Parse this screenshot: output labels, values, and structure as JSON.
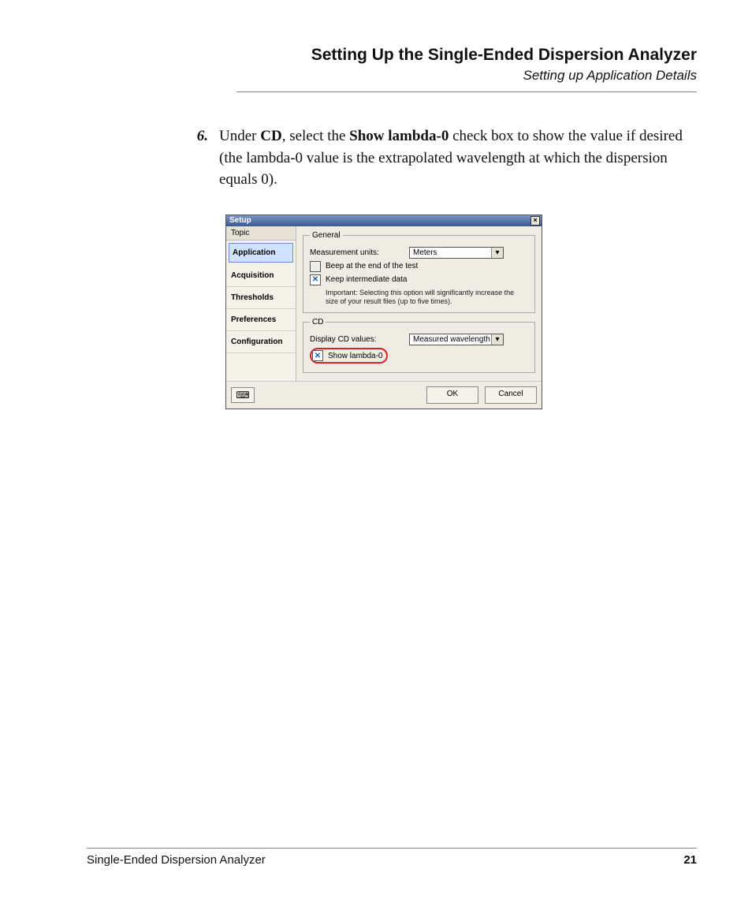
{
  "header": {
    "title": "Setting Up the Single-Ended Dispersion Analyzer",
    "subtitle": "Setting up Application Details"
  },
  "step": {
    "number": "6.",
    "prefix": "Under ",
    "b1": "CD",
    "mid1": ", select the ",
    "b2": "Show lambda-0",
    "rest": " check box to show the value if desired (the lambda-0 value is the extrapolated wavelength at which the dispersion equals 0)."
  },
  "window": {
    "title": "Setup",
    "close": "×",
    "sidebar": {
      "header": "Topic",
      "items": [
        "Application",
        "Acquisition",
        "Thresholds",
        "Preferences",
        "Configuration"
      ],
      "selected_index": 0
    },
    "general": {
      "legend": "General",
      "units_label": "Measurement units:",
      "units_value": "Meters",
      "beep_label": "Beep at the end of the test",
      "keep_label": "Keep intermediate data",
      "note": "Important: Selecting this option will significantly increase the size of your result files (up to five times)."
    },
    "cd": {
      "legend": "CD",
      "display_label": "Display CD values:",
      "display_value": "Measured wavelength",
      "show_lambda_label": "Show lambda-0"
    },
    "buttons": {
      "ok": "OK",
      "cancel": "Cancel"
    }
  },
  "footer": {
    "doc": "Single-Ended Dispersion Analyzer",
    "page": "21"
  }
}
